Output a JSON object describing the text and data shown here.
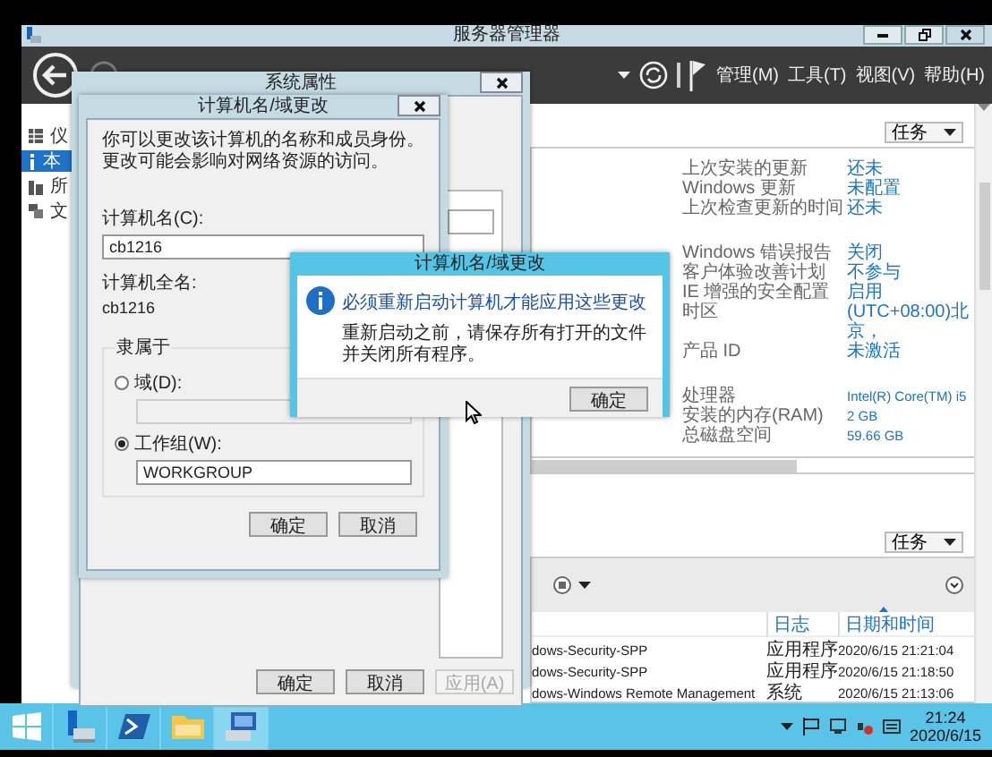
{
  "server_manager": {
    "title": "服务器管理器",
    "menus": [
      "管理(M)",
      "工具(T)",
      "视图(V)",
      "帮助(H)"
    ],
    "sidebar": [
      {
        "kind": "dashboard",
        "label": "仪",
        "selected": false
      },
      {
        "kind": "info",
        "label": "本",
        "selected": true
      },
      {
        "kind": "servers",
        "label": "所",
        "selected": false
      },
      {
        "kind": "files",
        "label": "文",
        "selected": false
      }
    ],
    "properties": {
      "tasks": "任务",
      "groups": [
        [
          {
            "label": "上次安装的更新",
            "value": "还未"
          },
          {
            "label": "Windows 更新",
            "value": "未配置"
          },
          {
            "label": "上次检查更新的时间",
            "value": "还未"
          }
        ],
        [
          {
            "label": "Windows 错误报告",
            "value": "关闭"
          },
          {
            "label": "客户体验改善计划",
            "value": "不参与"
          },
          {
            "label": "IE 增强的安全配置",
            "value": "启用"
          },
          {
            "label": "时区",
            "value": "(UTC+08:00)北京，"
          },
          {
            "label": "产品 ID",
            "value": "未激活"
          }
        ],
        [
          {
            "label": "处理器",
            "value": "Intel(R) Core(TM) i5"
          },
          {
            "label": "安装的内存(RAM)",
            "value": "2 GB"
          },
          {
            "label": "总磁盘空间",
            "value": "59.66 GB"
          }
        ]
      ]
    },
    "events": {
      "tasks": "任务",
      "columns": [
        {
          "label": "日志",
          "sorted": false
        },
        {
          "label": "日期和时间",
          "sorted": true
        }
      ],
      "rows": [
        {
          "source": "dows-Security-SPP",
          "log": "应用程序",
          "date": "2020/6/15 21:21:04"
        },
        {
          "source": "dows-Security-SPP",
          "log": "应用程序",
          "date": "2020/6/15 21:18:50"
        },
        {
          "source": "dows-Windows Remote Management",
          "log": "系统",
          "date": "2020/6/15 21:13:06"
        }
      ]
    }
  },
  "system_properties": {
    "title": "系统属性",
    "buttons": [
      {
        "label": "确定",
        "disabled": false
      },
      {
        "label": "取消",
        "disabled": false
      },
      {
        "label": "应用(A)",
        "disabled": true
      }
    ]
  },
  "name_dialog": {
    "title": "计算机名/域更改",
    "description": "你可以更改该计算机的名称和成员身份。更改可能会影响对网络资源的访问。",
    "name_label": "计算机名(C):",
    "name_value": "cb1216",
    "full_name_label": "计算机全名:",
    "full_name": "cb1216",
    "member_of": {
      "title": "隶属于",
      "options": [
        {
          "label": "域(D):",
          "selected": false
        },
        {
          "label": "工作组(W):",
          "selected": true,
          "value": "WORKGROUP"
        }
      ]
    },
    "buttons": [
      "确定",
      "取消"
    ]
  },
  "message_box": {
    "title": "计算机名/域更改",
    "instruction": "必须重新启动计算机才能应用这些更改",
    "text": "重新启动之前，请保存所有打开的文件并关闭所有程序。",
    "button": "确定"
  },
  "taskbar": {
    "apps": [
      {
        "kind": "server-manager",
        "selected": false
      },
      {
        "kind": "powershell",
        "selected": false
      },
      {
        "kind": "explorer",
        "selected": false
      },
      {
        "kind": "system",
        "selected": true
      }
    ],
    "clock": {
      "time": "21:24",
      "date": "2020/6/15"
    }
  }
}
